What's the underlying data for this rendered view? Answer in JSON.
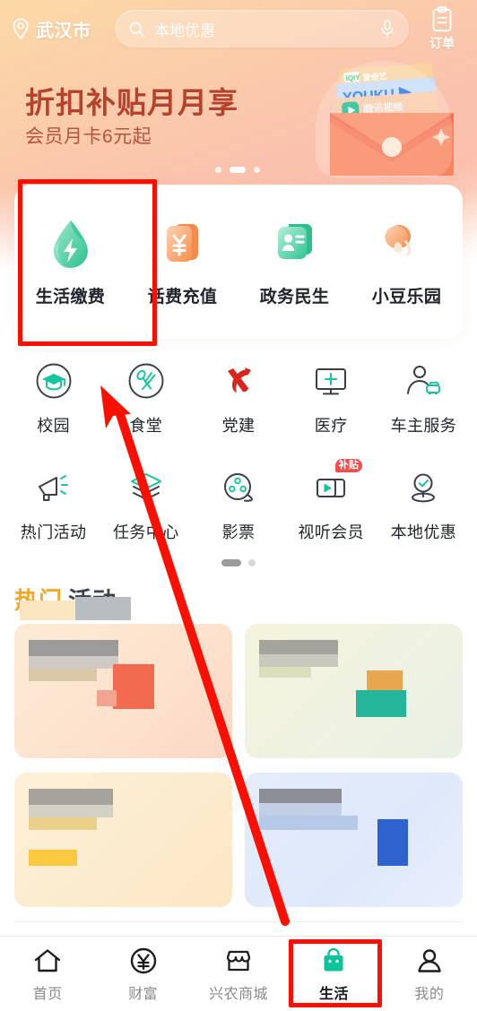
{
  "header": {
    "location": "武汉市",
    "location_icon": "map-pin-icon",
    "search_placeholder": "本地优惠",
    "search_icon": "search-icon",
    "mic_icon": "microphone-icon",
    "orders_label": "订单",
    "orders_icon": "clipboard-icon"
  },
  "banner": {
    "title": "折扣补贴月月享",
    "subtitle": "会员月卡6元起",
    "brands": [
      "爱奇艺",
      "YOUKU",
      "腾讯视频"
    ],
    "dots_total": 3,
    "dots_active": 2
  },
  "quick_tiles": [
    {
      "label": "生活缴费",
      "icon": "water-drop-bolt-icon",
      "highlighted": true
    },
    {
      "label": "话费充值",
      "icon": "yen-card-icon",
      "highlighted": false
    },
    {
      "label": "政务民生",
      "icon": "id-card-icon",
      "highlighted": false
    },
    {
      "label": "小豆乐园",
      "icon": "bean-icon",
      "highlighted": false
    }
  ],
  "grid": {
    "rows": [
      [
        {
          "label": "校园",
          "icon": "graduation-cap-icon",
          "badge": ""
        },
        {
          "label": "食堂",
          "icon": "spoon-fork-icon",
          "badge": ""
        },
        {
          "label": "党建",
          "icon": "hammer-sickle-icon",
          "badge": ""
        },
        {
          "label": "医疗",
          "icon": "monitor-plus-icon",
          "badge": ""
        },
        {
          "label": "车主服务",
          "icon": "person-car-icon",
          "badge": ""
        }
      ],
      [
        {
          "label": "热门活动",
          "icon": "megaphone-icon",
          "badge": ""
        },
        {
          "label": "任务中心",
          "icon": "stacked-layers-icon",
          "badge": ""
        },
        {
          "label": "影票",
          "icon": "film-reel-icon",
          "badge": ""
        },
        {
          "label": "视听会员",
          "icon": "video-play-icon",
          "badge": "补贴"
        },
        {
          "label": "本地优惠",
          "icon": "pin-check-icon",
          "badge": ""
        }
      ]
    ],
    "dots_total": 2,
    "dots_active": 1
  },
  "hot_section": {
    "title_part1": "热门",
    "title_part2": "活动",
    "cards": [
      {
        "name": "card-1",
        "style": "c1"
      },
      {
        "name": "card-2",
        "style": "c2"
      },
      {
        "name": "card-3",
        "style": "c3"
      },
      {
        "name": "card-4",
        "style": "c4"
      }
    ]
  },
  "tabbar": {
    "items": [
      {
        "label": "首页",
        "icon": "home-icon",
        "active": false
      },
      {
        "label": "财富",
        "icon": "yen-circle-icon",
        "active": false
      },
      {
        "label": "兴农商城",
        "icon": "storefront-icon",
        "active": false
      },
      {
        "label": "生活",
        "icon": "shopping-bag-icon",
        "active": true
      },
      {
        "label": "我的",
        "icon": "person-icon",
        "active": false
      }
    ]
  },
  "annotations": {
    "accent_color": "#fa0f00",
    "active_tab_color": "#0bc49a",
    "highlight_boxes": [
      "生活缴费",
      "生活"
    ],
    "arrow": "red-arrow-pointing-to-生活缴费"
  }
}
